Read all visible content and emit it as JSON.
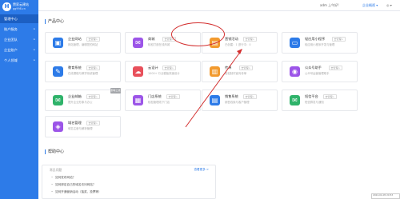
{
  "brand": {
    "name": "赞家云建站",
    "url": "gg998.cn",
    "mark": "H"
  },
  "sidebar": {
    "items": [
      {
        "label": "管理中心",
        "arrow": ""
      },
      {
        "label": "账户服务",
        "arrow": "▸"
      },
      {
        "label": "企业团队",
        "arrow": "▸"
      },
      {
        "label": "企业账户",
        "arrow": "▸"
      },
      {
        "label": "个人领域",
        "arrow": "▸"
      }
    ]
  },
  "topbar": {
    "greeting": "adm 上午好!",
    "ticket": "企业概视 ▾",
    "user": "◎ ▾"
  },
  "product_section": {
    "title": "产品中心"
  },
  "cards": [
    {
      "title": "企业网站",
      "badge": "去管理>",
      "desc": "网站管理，编辑您的网站",
      "icon": "▣",
      "icon_name": "website-icon",
      "color": "#2d7be8",
      "tag": ""
    },
    {
      "title": "商城",
      "badge": "去管理>",
      "desc": "轻松打造在线商城",
      "icon": "✉",
      "icon_name": "mall-icon",
      "color": "#9c55e8",
      "tag": ""
    },
    {
      "title": "营销活动",
      "badge": "去管理>",
      "desc": "已创建：1    进行中：0",
      "icon": "▤",
      "icon_name": "marketing-icon",
      "color": "#f29a2e",
      "tag": ""
    },
    {
      "title": "轻应用小程序",
      "badge": "去管理>",
      "desc": "轻应用小程序开发与管理",
      "icon": "▭",
      "icon_name": "mini-program-icon",
      "color": "#2d7be8",
      "tag": ""
    },
    {
      "title": "教育系统",
      "badge": "去管理>",
      "desc": "在线课程与教学系统管理",
      "icon": "✎",
      "icon_name": "education-icon",
      "color": "#2d7be8",
      "tag": ""
    },
    {
      "title": "云设计",
      "badge": "去管理>",
      "desc": "1000+ 行业模板快速设计",
      "icon": "☁",
      "icon_name": "cloud-design-icon",
      "color": "#e8505b",
      "tag": ""
    },
    {
      "title": "传单",
      "badge": "去管理>",
      "desc": "轻松制作宣传传单",
      "icon": "▥",
      "icon_name": "flyer-icon",
      "color": "#f29a2e",
      "tag": ""
    },
    {
      "title": "公众号助手",
      "badge": "去管理>",
      "desc": "公众号运营管理助手",
      "icon": "◉",
      "icon_name": "official-account-icon",
      "color": "#9c55e8",
      "tag": ""
    },
    {
      "title": "企业邮箱",
      "badge": "去管理>",
      "desc": "提升企业形象与办公",
      "icon": "✉",
      "icon_name": "mailbox-icon",
      "color": "#2fb36a",
      "tag": "即将上线"
    },
    {
      "title": "门店系统",
      "badge": "去管理>",
      "desc": "轻松管理线下门店",
      "icon": "▦",
      "icon_name": "store-icon",
      "color": "#9c55e8",
      "tag": ""
    },
    {
      "title": "销售系统",
      "badge": "去管理>",
      "desc": "销售线索与客户管理",
      "icon": "▤",
      "icon_name": "sales-icon",
      "color": "#2d7be8",
      "tag": ""
    },
    {
      "title": "短信平台",
      "badge": "去管理>",
      "desc": "短信群发与通知",
      "icon": "✉",
      "icon_name": "sms-icon",
      "color": "#2fb36a",
      "tag": ""
    },
    {
      "title": "域名管理",
      "badge": "去管理>",
      "desc": "域名注册与解析管理",
      "icon": "◈",
      "icon_name": "domain-icon",
      "color": "#9c55e8",
      "tag": ""
    }
  ],
  "help_section": {
    "title": "帮助中心",
    "head": "常见问题",
    "more": "查看更多 >",
    "items": [
      "如何发布网站？",
      "如何绑定自己的域名访问网站？",
      "如何开通营销活动（抽奖、投票等）"
    ]
  },
  "float_tip": "2024-04-05 20:53"
}
